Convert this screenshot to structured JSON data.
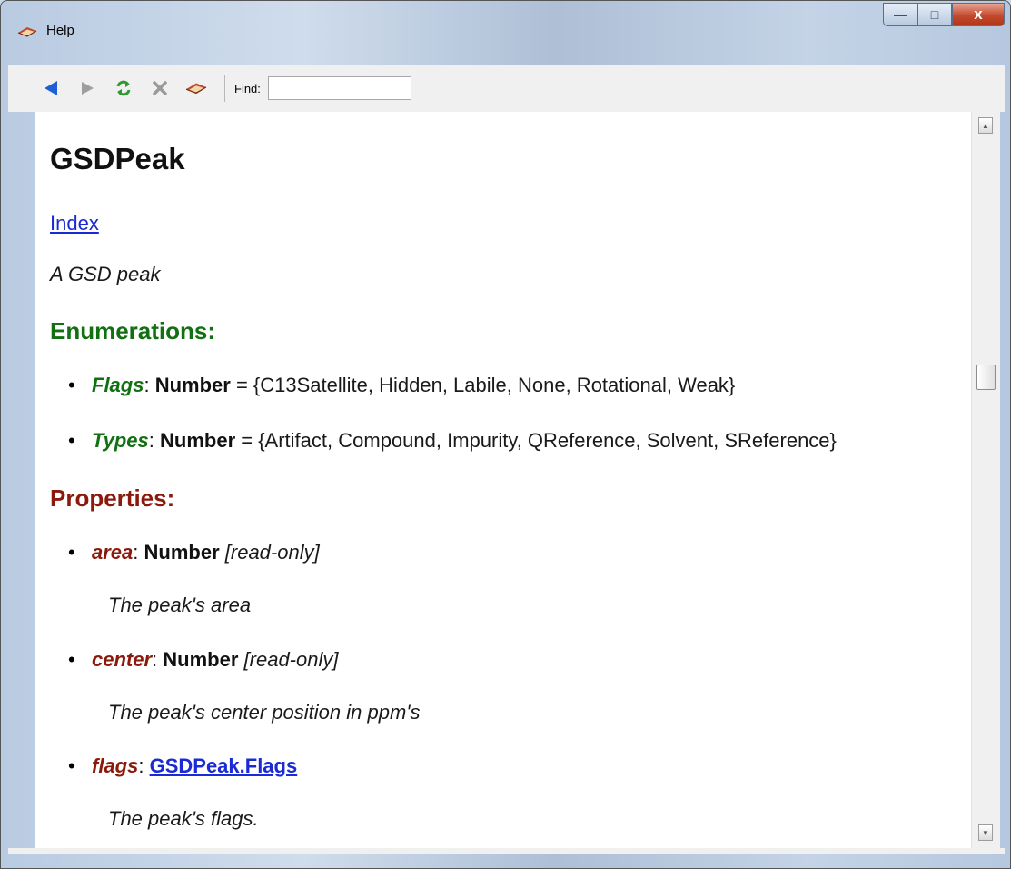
{
  "window": {
    "title": "Help",
    "icon": "help-book-icon"
  },
  "title_controls": {
    "minimize": "—",
    "maximize": "□",
    "close": "x"
  },
  "toolbar": {
    "buttons": [
      "back-arrow-icon",
      "forward-arrow-icon",
      "refresh-icon",
      "stop-icon",
      "home-icon"
    ],
    "find_label": "Find:",
    "find_value": ""
  },
  "page": {
    "title": "GSDPeak",
    "index_link": "Index",
    "description": "A GSD peak",
    "enumerations_heading": "Enumerations:",
    "enumerations": [
      {
        "name": "Flags",
        "sep": ": ",
        "type": "Number",
        "values": " = {C13Satellite, Hidden, Labile, None, Rotational, Weak}"
      },
      {
        "name": "Types",
        "sep": ": ",
        "type": "Number",
        "values": " = {Artifact, Compound, Impurity, QReference, Solvent, SReference}"
      }
    ],
    "properties_heading": "Properties:",
    "properties": [
      {
        "name": "area",
        "sep": ": ",
        "type": "Number",
        "readonly": "[read-only]",
        "description": "The peak's area"
      },
      {
        "name": "center",
        "sep": ": ",
        "type": "Number",
        "readonly": "[read-only]",
        "description": "The peak's center position in ppm's"
      },
      {
        "name": "flags",
        "sep": ": ",
        "type_link": "GSDPeak.Flags",
        "description": "The peak's flags."
      }
    ]
  },
  "colors": {
    "enum_green": "#127012",
    "property_red": "#8b1a0c",
    "link_blue": "#1a2bd6"
  }
}
